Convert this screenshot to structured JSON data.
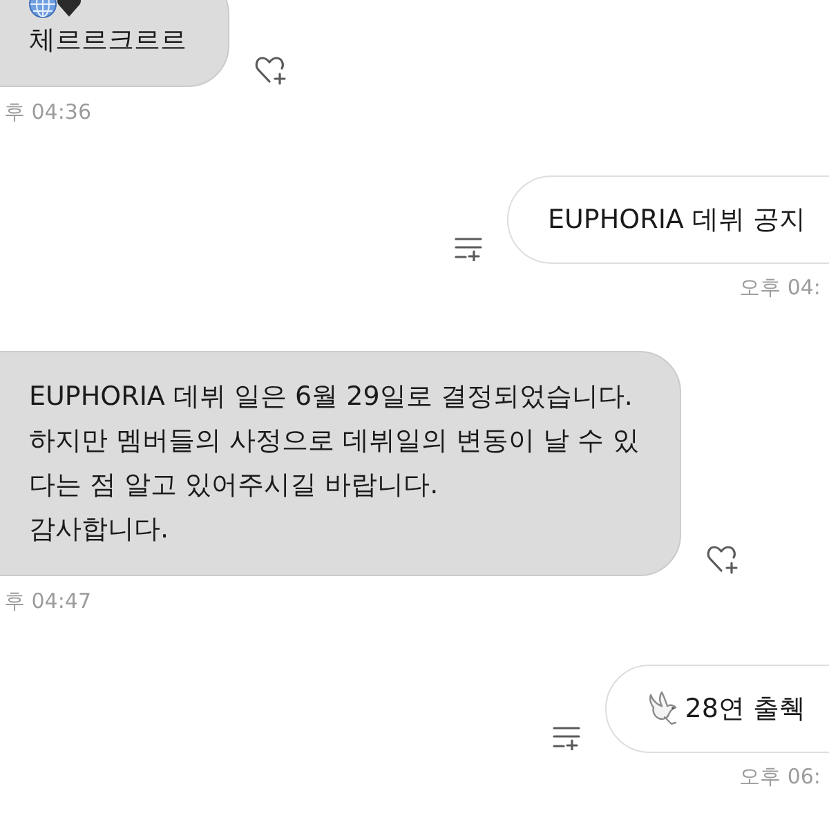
{
  "messages": [
    {
      "kind": "received",
      "icon_row": true,
      "lines": [
        "체르르크르르"
      ],
      "time": "후 04:36"
    },
    {
      "kind": "sent",
      "lines": [
        "EUPHORIA 데뷔 공지"
      ],
      "time": "오후 04:"
    },
    {
      "kind": "received",
      "lines": [
        "EUPHORIA 데뷔 일은 6월 29일로 결정되었습니다.",
        "하지만 멤버들의 사정으로 데뷔일의 변동이 날 수 있",
        "다는 점 알고 있어주시길 바랍니다.",
        "감사합니다."
      ],
      "time": "후 04:47"
    },
    {
      "kind": "sent",
      "leading_icon": true,
      "lines": [
        "28연 출췍"
      ],
      "time": "오후 06:"
    }
  ]
}
